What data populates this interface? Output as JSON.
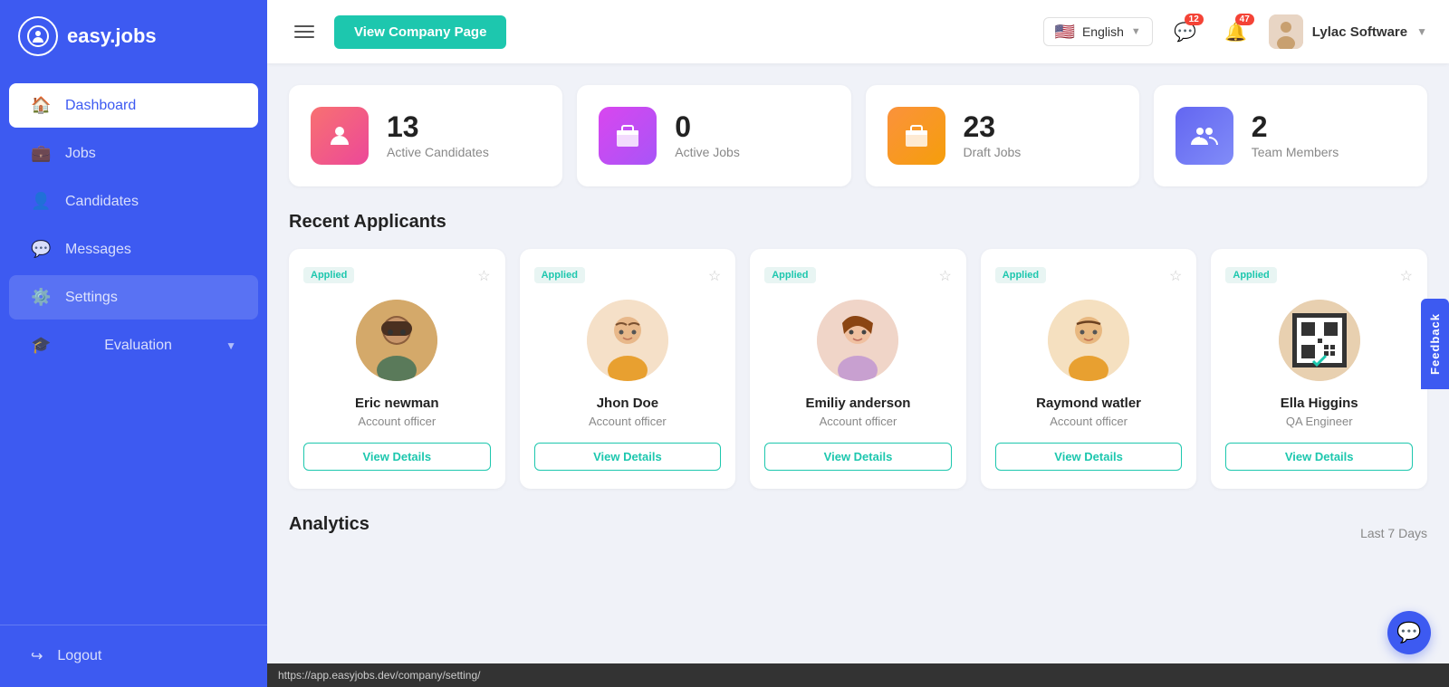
{
  "app": {
    "name": "easy.jobs"
  },
  "sidebar": {
    "items": [
      {
        "id": "dashboard",
        "label": "Dashboard",
        "icon": "🏠",
        "active": true
      },
      {
        "id": "jobs",
        "label": "Jobs",
        "icon": "💼",
        "active": false
      },
      {
        "id": "candidates",
        "label": "Candidates",
        "icon": "👤",
        "active": false
      },
      {
        "id": "messages",
        "label": "Messages",
        "icon": "💬",
        "active": false
      },
      {
        "id": "settings",
        "label": "Settings",
        "icon": "⚙️",
        "active": false
      },
      {
        "id": "evaluation",
        "label": "Evaluation",
        "icon": "🎓",
        "active": false
      }
    ],
    "logout_label": "Logout"
  },
  "header": {
    "view_company_btn": "View Company Page",
    "language": "English",
    "messages_badge": "12",
    "notifications_badge": "47",
    "user_name": "Lylac Software"
  },
  "stats": [
    {
      "id": "active-candidates",
      "number": "13",
      "label": "Active Candidates",
      "icon": "👤",
      "color_class": "stat-icon-pink"
    },
    {
      "id": "active-jobs",
      "number": "0",
      "label": "Active Jobs",
      "icon": "💼",
      "color_class": "stat-icon-magenta"
    },
    {
      "id": "draft-jobs",
      "number": "23",
      "label": "Draft Jobs",
      "icon": "💼",
      "color_class": "stat-icon-orange"
    },
    {
      "id": "team-members",
      "number": "2",
      "label": "Team Members",
      "icon": "👥",
      "color_class": "stat-icon-blue"
    }
  ],
  "recent_applicants": {
    "title": "Recent Applicants",
    "applicants": [
      {
        "id": 1,
        "name": "Eric newman",
        "role": "Account officer",
        "status": "Applied",
        "avatar_class": "avatar-1"
      },
      {
        "id": 2,
        "name": "Jhon Doe",
        "role": "Account officer",
        "status": "Applied",
        "avatar_class": "avatar-2"
      },
      {
        "id": 3,
        "name": "Emiliy anderson",
        "role": "Account officer",
        "status": "Applied",
        "avatar_class": "avatar-3"
      },
      {
        "id": 4,
        "name": "Raymond watler",
        "role": "Account officer",
        "status": "Applied",
        "avatar_class": "avatar-4"
      },
      {
        "id": 5,
        "name": "Ella Higgins",
        "role": "QA Engineer",
        "status": "Applied",
        "avatar_class": "avatar-5"
      }
    ],
    "view_details_label": "View Details"
  },
  "analytics": {
    "title": "Analytics",
    "period": "Last 7 Days"
  },
  "status_bar": {
    "url": "https://app.easyjobs.dev/company/setting/"
  },
  "feedback_label": "Feedback",
  "chat_icon": "💬"
}
